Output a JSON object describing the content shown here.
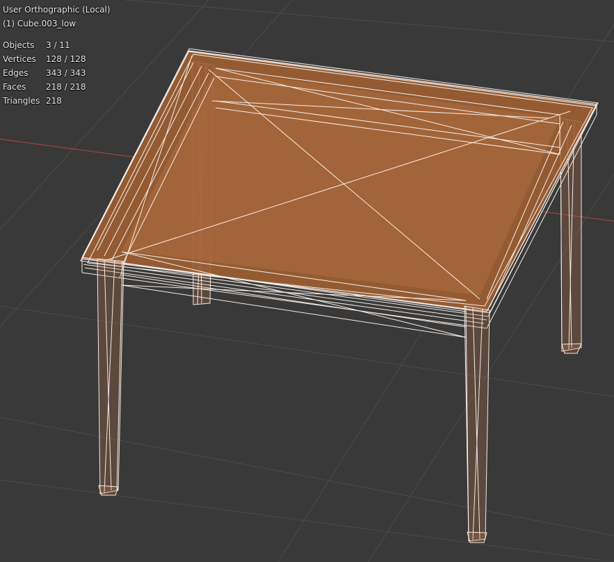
{
  "viewport": {
    "view_name": "User Orthographic (Local)",
    "active_object": "(1) Cube.003_low"
  },
  "stats": [
    {
      "label": "Objects",
      "value": "3 / 11"
    },
    {
      "label": "Vertices",
      "value": "128 / 128"
    },
    {
      "label": "Edges",
      "value": "343 / 343"
    },
    {
      "label": "Faces",
      "value": "218 / 218"
    },
    {
      "label": "Triangles",
      "value": "218"
    }
  ],
  "colors": {
    "background": "#393939",
    "grid_line": "#4a4a4a",
    "x_axis": "#b04848",
    "face_fill": "#b06a38",
    "wire": "#f6ece4"
  }
}
